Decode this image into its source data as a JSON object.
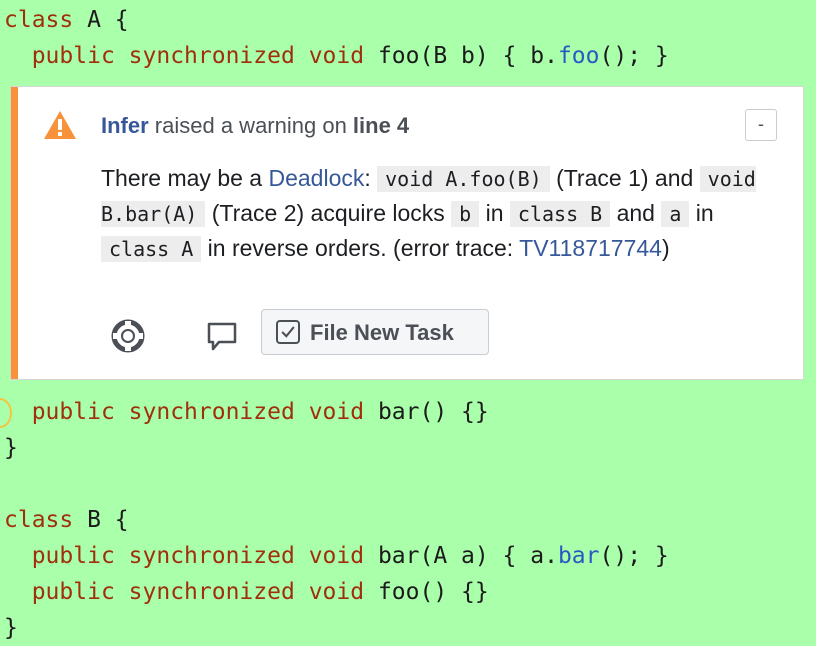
{
  "code_top": {
    "line1": {
      "kw": "class",
      "rest": " A {"
    },
    "line2": {
      "kw1": "public",
      "kw2": "synchronized",
      "kw3": "void",
      "sig": "foo(B b) { b.",
      "call": "foo",
      "tail": "(); }"
    },
    "line3": {
      "kw1": "public",
      "kw2": "synchronized",
      "kw3": "void",
      "sig": "bar() {}"
    },
    "line4": "}"
  },
  "code_bottom": {
    "line1": {
      "kw": "class",
      "rest": " B {"
    },
    "line2": {
      "kw1": "public",
      "kw2": "synchronized",
      "kw3": "void",
      "sig": "bar(A a) { a.",
      "call": "bar",
      "tail": "(); }"
    },
    "line3": {
      "kw1": "public",
      "kw2": "synchronized",
      "kw3": "void",
      "sig": "foo() {}"
    },
    "line4": "}"
  },
  "warning": {
    "tool": "Infer",
    "mid": " raised a warning on ",
    "line": "line 4",
    "collapse_label": "-",
    "msg": {
      "p1": "There may be a ",
      "link": "Deadlock",
      "p2": ": ",
      "code1": "void A.foo(B)",
      "p3": " (Trace 1) and ",
      "code2": "void B.bar(A)",
      "p4": " (Trace 2) acquire locks ",
      "code3": "b",
      "p5": " in ",
      "code4": "class B",
      "p6": " and ",
      "code5": "a",
      "p7": " in ",
      "code6": "class A",
      "p8": " in reverse orders. (error trace: ",
      "trace_link": "TV118717744",
      "p9": ")"
    },
    "task_button_label": "File New Task",
    "icons": [
      "warning-icon",
      "help-lifebuoy-icon",
      "comment-icon",
      "checkbox-icon"
    ]
  },
  "colors": {
    "background": "#aaffaa",
    "keyword": "#a0300d",
    "accent": "#f7913a",
    "link": "#365899"
  }
}
